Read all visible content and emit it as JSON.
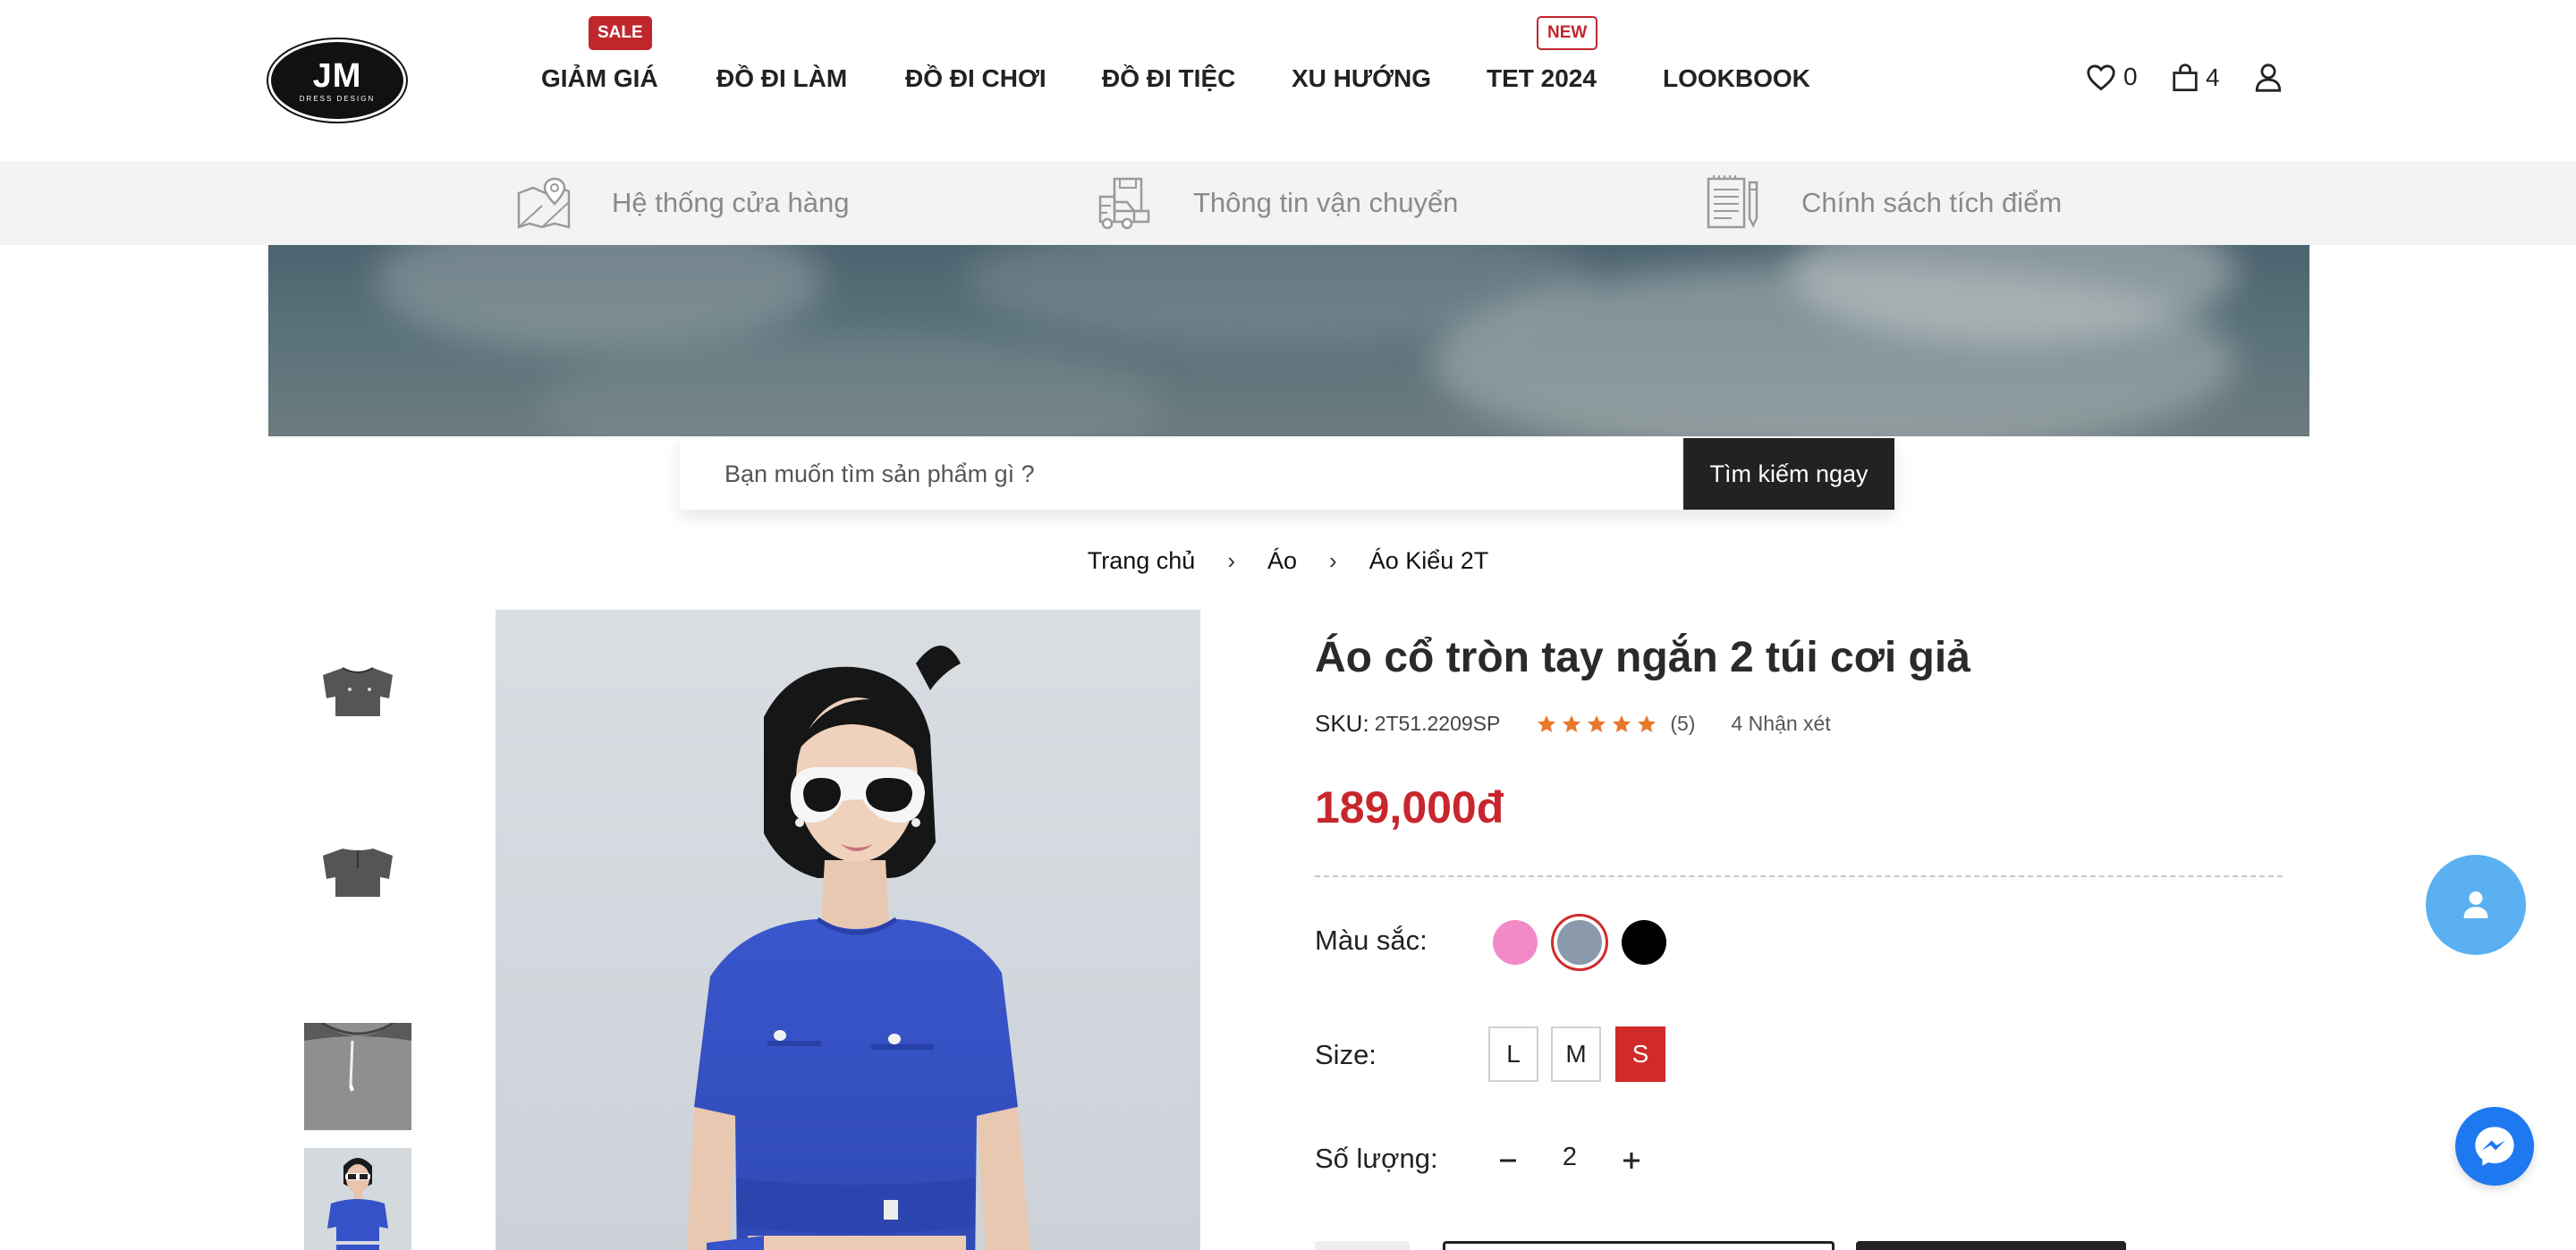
{
  "logo": {
    "main": "JM",
    "sub": "DRESS DESIGN"
  },
  "nav": {
    "items": [
      {
        "label": "GIẢM GIÁ"
      },
      {
        "label": "ĐỒ ĐI LÀM"
      },
      {
        "label": "ĐỒ ĐI CHƠI"
      },
      {
        "label": "ĐỒ ĐI TIỆC"
      },
      {
        "label": "XU HƯỚNG"
      },
      {
        "label": "TET 2024"
      },
      {
        "label": "LOOKBOOK"
      }
    ],
    "badges": {
      "sale": "SALE",
      "new": "NEW"
    }
  },
  "header_icons": {
    "wishlist_count": "0",
    "cart_count": "4",
    "wishlist_icon": "heart-icon",
    "cart_icon": "bag-icon",
    "account_icon": "user-icon"
  },
  "infobar": {
    "items": [
      {
        "label": "Hệ thống cửa hàng",
        "icon": "map-pin-icon"
      },
      {
        "label": "Thông tin vận chuyển",
        "icon": "delivery-truck-icon"
      },
      {
        "label": "Chính sách tích điểm",
        "icon": "document-pen-icon"
      }
    ]
  },
  "search": {
    "placeholder": "Bạn muốn tìm sản phẩm gì ?",
    "button": "Tìm kiếm ngay"
  },
  "breadcrumb": {
    "items": [
      "Trang chủ",
      "Áo",
      "Áo Kiểu 2T"
    ],
    "separator": "›"
  },
  "product": {
    "title": "Áo cổ tròn tay ngắn 2 túi cơi giả",
    "sku_label": "SKU:",
    "sku": "2T51.2209SP",
    "rating": 5,
    "rating_count": "(5)",
    "reviews": "4 Nhận xét",
    "price": "189,000đ",
    "color_label": "Màu sắc:",
    "colors": [
      "#f28ac8",
      "#8a9aaa",
      "#000000"
    ],
    "selected_color_index": 1,
    "size_label": "Size:",
    "sizes": [
      "L",
      "M",
      "S"
    ],
    "selected_size": "S",
    "qty_label": "Số lượng:",
    "qty": "2"
  },
  "colors": {
    "accent_red": "#c8262d",
    "star": "#e8782a",
    "float_user": "#5ab0f0",
    "messenger": "#1e78f0"
  }
}
